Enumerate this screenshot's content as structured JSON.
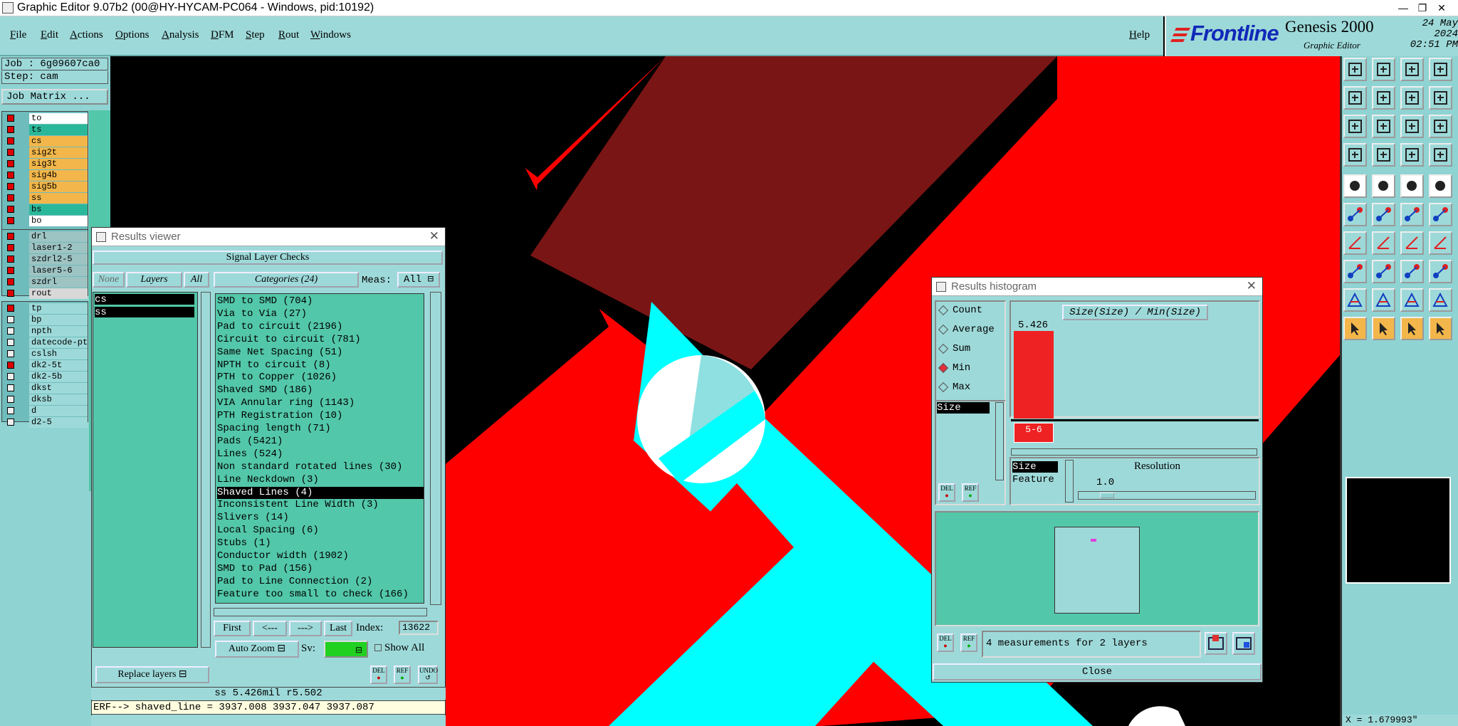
{
  "window": {
    "title": "Graphic Editor 9.07b2 (00@HY-HYCAM-PC064 - Windows, pid:10192)",
    "controls": [
      "—",
      "❐",
      "✕"
    ]
  },
  "menu": {
    "items": [
      "File",
      "Edit",
      "Actions",
      "Options",
      "Analysis",
      "DFM",
      "Step",
      "Rout",
      "Windows"
    ],
    "help": "Help"
  },
  "brand": {
    "logo": "Frontline",
    "product": "Genesis 2000",
    "subtitle": "Graphic Editor",
    "date": "24 May 2024",
    "time": "02:51 PM"
  },
  "left_panel": {
    "job": "Job : 6g09607ca0",
    "step": "Step: cam",
    "job_matrix": "Job Matrix ...",
    "board_layers": [
      {
        "name": "to",
        "color": "#ffffff",
        "on": true
      },
      {
        "name": "ts",
        "color": "#2bb89a",
        "on": true
      },
      {
        "name": "cs",
        "color": "#f2b64a",
        "on": true
      },
      {
        "name": "sig2t",
        "color": "#f2b64a",
        "on": true
      },
      {
        "name": "sig3t",
        "color": "#f2b64a",
        "on": true
      },
      {
        "name": "sig4b",
        "color": "#f2b64a",
        "on": true
      },
      {
        "name": "sig5b",
        "color": "#f2b64a",
        "on": true
      },
      {
        "name": "ss",
        "color": "#f2b64a",
        "on": true
      },
      {
        "name": "bs",
        "color": "#2bb89a",
        "on": true
      },
      {
        "name": "bo",
        "color": "#ffffff",
        "on": true
      }
    ],
    "drill_layers": [
      {
        "name": "drl",
        "color": "#9ec3c3",
        "on": true
      },
      {
        "name": "laser1-2",
        "color": "#9ec3c3",
        "on": true
      },
      {
        "name": "szdrl2-5",
        "color": "#9ec3c3",
        "on": true
      },
      {
        "name": "laser5-6",
        "color": "#9ec3c3",
        "on": true
      },
      {
        "name": "szdrl",
        "color": "#9ec3c3",
        "on": true
      },
      {
        "name": "rout",
        "color": "#d8d8d8",
        "on": true
      }
    ],
    "misc_layers": [
      {
        "name": "tp",
        "color": "#9ed9d9",
        "on": true
      },
      {
        "name": "bp",
        "color": "#9ed9d9",
        "on": false
      },
      {
        "name": "npth",
        "color": "#9ed9d9",
        "on": false
      },
      {
        "name": "datecode-pt",
        "color": "#9ed9d9",
        "on": false
      },
      {
        "name": "cslsh",
        "color": "#9ed9d9",
        "on": false
      },
      {
        "name": "dk2-5t",
        "color": "#9ed9d9",
        "on": true
      },
      {
        "name": "dk2-5b",
        "color": "#9ed9d9",
        "on": false
      },
      {
        "name": "dkst",
        "color": "#9ed9d9",
        "on": false
      },
      {
        "name": "dksb",
        "color": "#9ed9d9",
        "on": false
      },
      {
        "name": "d",
        "color": "#9ed9d9",
        "on": false
      },
      {
        "name": "d2-5",
        "color": "#9ed9d9",
        "on": false
      }
    ]
  },
  "results_viewer": {
    "title": "Results viewer",
    "header": "Signal Layer Checks",
    "none_btn": "None",
    "layers_btn": "Layers",
    "all_btn": "All",
    "layers": [
      "cs",
      "ss"
    ],
    "categories_btn": "Categories (24)",
    "meas_label": "Meas:",
    "meas_value": "All",
    "categories": [
      "SMD to SMD (704)",
      "Via to Via (27)",
      "Pad to circuit (2196)",
      "Circuit to circuit (781)",
      "Same Net Spacing (51)",
      "NPTH to circuit (8)",
      "PTH to Copper (1026)",
      "Shaved SMD (186)",
      "VIA Annular ring (1143)",
      "PTH Registration (10)",
      "Spacing length (71)",
      "Pads (5421)",
      "Lines (524)",
      "Non standard rotated lines (30)",
      "Line Neckdown (3)",
      "Shaved Lines (4)",
      "Inconsistent Line Width (3)",
      "Slivers (14)",
      "Local Spacing (6)",
      "Stubs (1)",
      "Conductor width (1902)",
      "SMD to Pad (156)",
      "Pad to Line Connection (2)",
      "Feature too small to check (166)"
    ],
    "selected_category": 15,
    "first_btn": "First",
    "prev_btn": "<---",
    "next_btn": "--->",
    "last_btn": "Last",
    "index_label": "Index:",
    "index_value": "13622",
    "auto_zoom": "Auto Zoom",
    "sv_label": "Sv:",
    "show_all": "Show All",
    "replace_layers": "Replace layers",
    "del_btn": "DEL",
    "ref_btn": "REF",
    "undo_btn": "UNDO"
  },
  "status": {
    "measure": "ss 5.426mil  r5.502",
    "erf": "ERF--> shaved_line = 3937.008 3937.047 3937.087"
  },
  "histogram": {
    "title": "Results histogram",
    "modes": [
      "Count",
      "Average",
      "Sum",
      "Min",
      "Max"
    ],
    "selected_mode": "Min",
    "chart_title": "Size(Size) / Min(Size)",
    "bar_value": "5.426",
    "bar_label": "5-6",
    "list_item": "Size",
    "size_label": "Size",
    "feature_label": "Feature",
    "resolution_label": "Resolution",
    "resolution_value": "1.0",
    "summary": "4 measurements for 2 layers",
    "close_btn": "Close",
    "del_btn": "DEL",
    "ref_btn": "REF"
  },
  "coords": {
    "x": "X = 1.679993\""
  },
  "colors": {
    "panel": "#9ed9d9",
    "panel_dark": "#53c7a9",
    "accent_red": "#ff0000",
    "cyan": "#00ffff"
  }
}
